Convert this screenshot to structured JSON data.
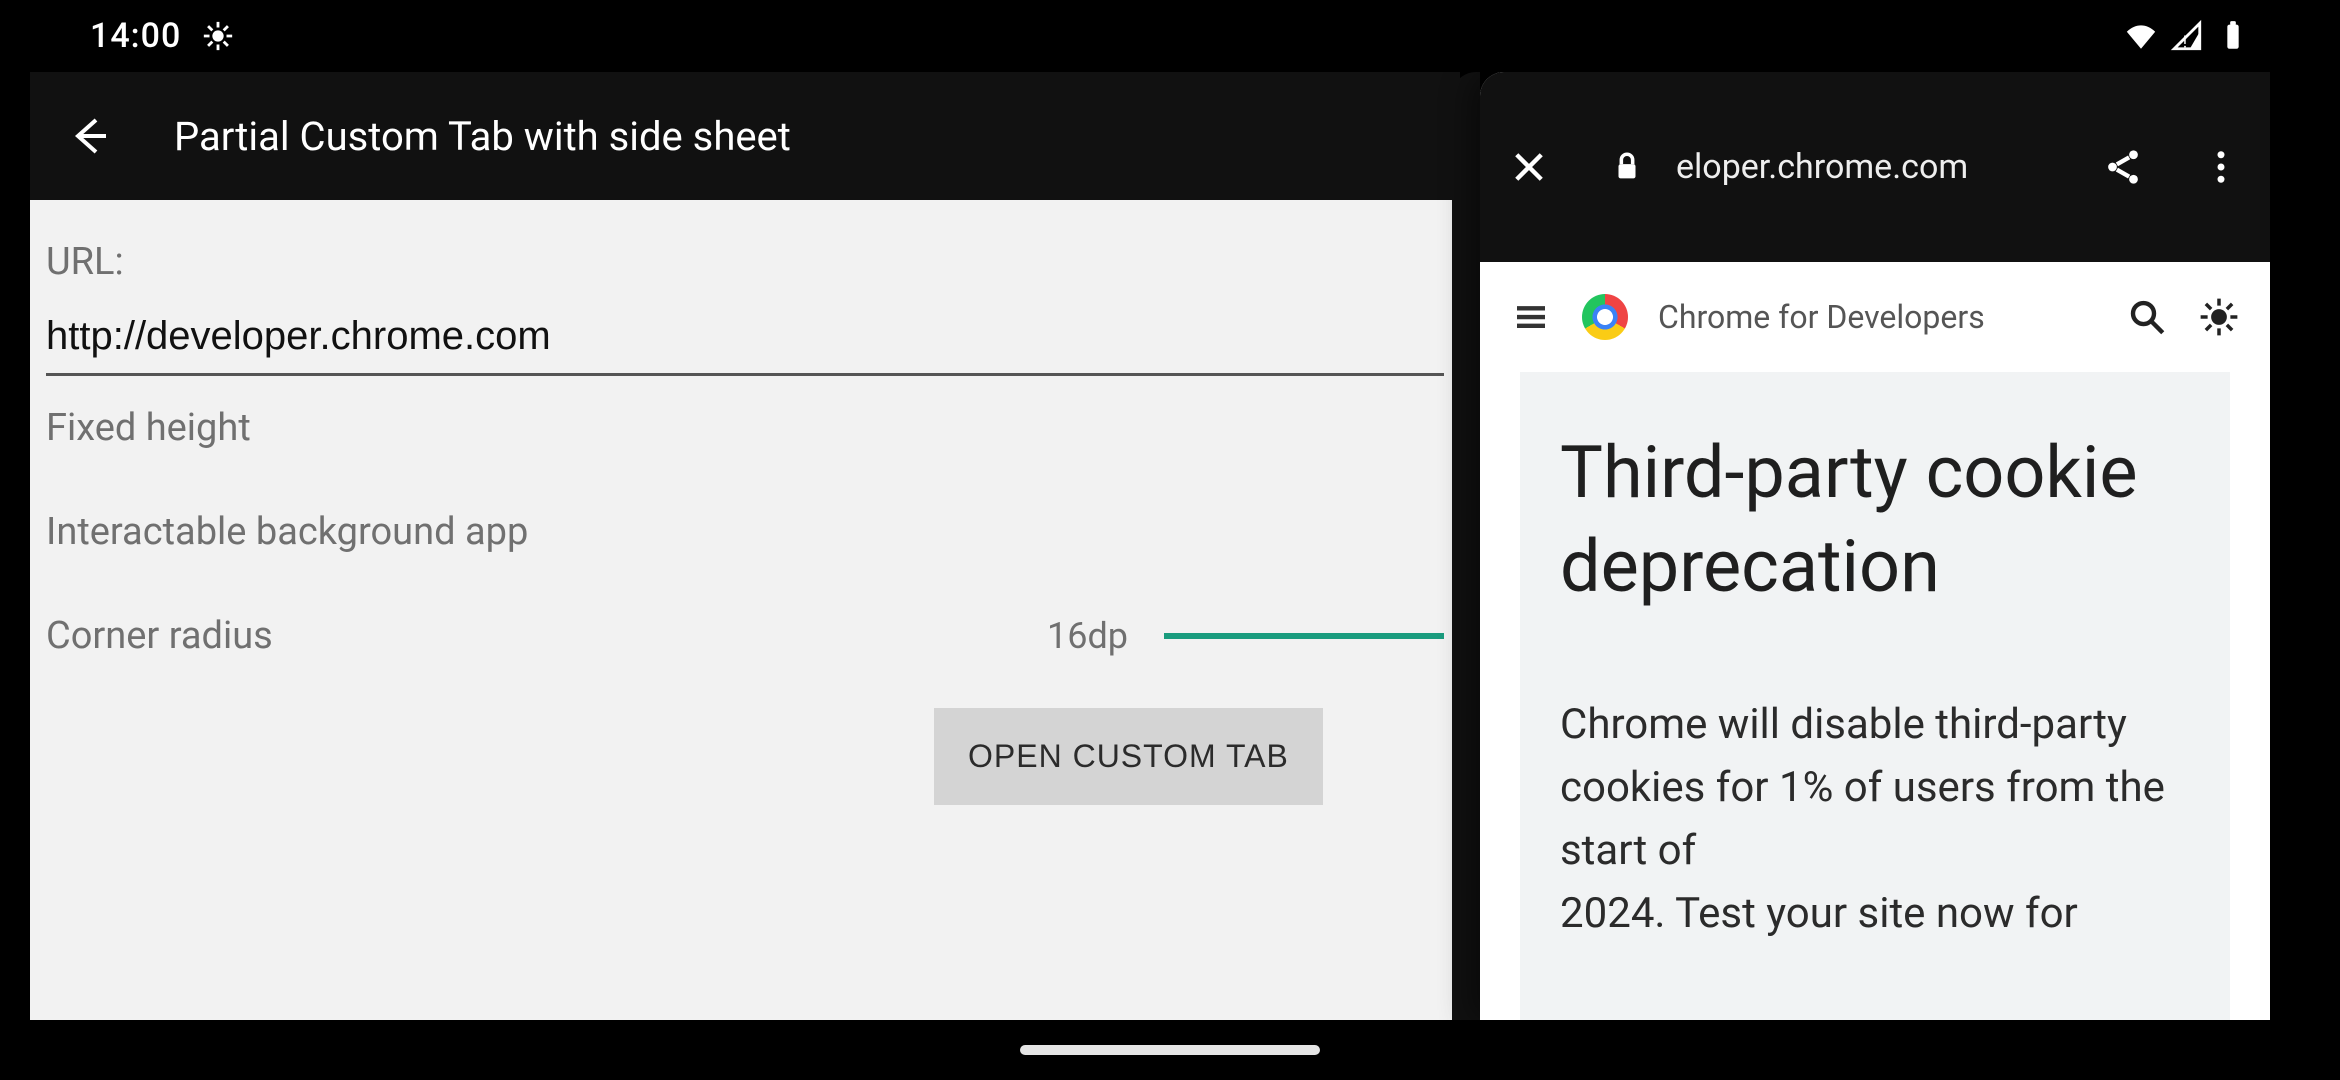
{
  "status_bar": {
    "time": "14:00"
  },
  "app": {
    "title": "Partial Custom Tab with side sheet",
    "url_label": "URL:",
    "url_value": "http://developer.chrome.com",
    "options": {
      "fixed_height_label": "Fixed height",
      "interactable_bg_label": "Interactable background app",
      "corner_radius_label": "Corner radius",
      "corner_radius_value": "16dp"
    },
    "open_button_label": "OPEN CUSTOM TAB"
  },
  "custom_tab": {
    "host_display": "eloper.chrome.com"
  },
  "site": {
    "brand": "Chrome for Developers",
    "article_title": "Third-party cookie deprecation",
    "article_body_visible": "Chrome will disable third-party cookies for 1% of users from the start of",
    "article_body_cut": "2024. Test your site now for"
  }
}
